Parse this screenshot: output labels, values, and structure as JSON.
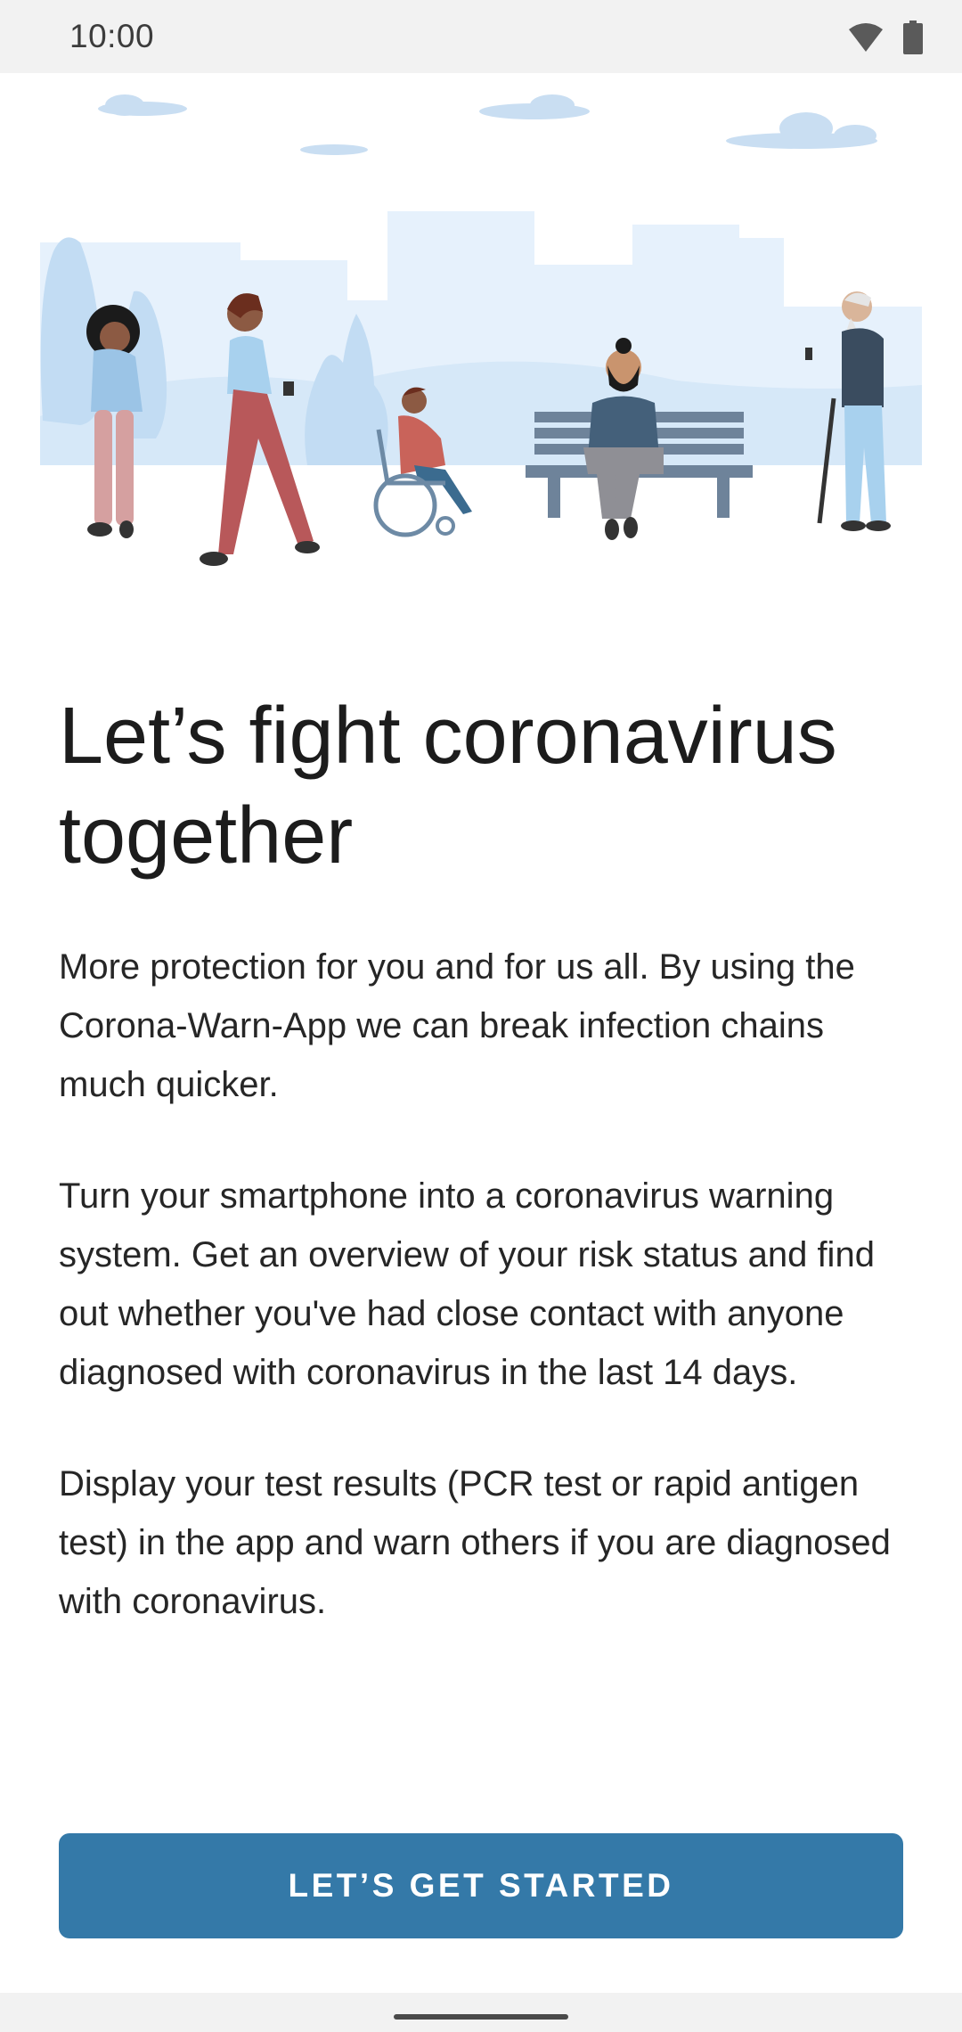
{
  "status_bar": {
    "time": "10:00",
    "icons": [
      "wifi-icon",
      "battery-icon"
    ]
  },
  "hero": {
    "illustration": "people-in-city-park-illustration"
  },
  "content": {
    "headline": "Let’s fight coronavirus together",
    "paragraphs": [
      "More protection for you and for us all. By using the Corona-Warn-App we can break infection chains much quicker.",
      "Turn your smartphone into a coronavirus warning system. Get an overview of your risk status and find out whether you've had close contact with anyone diagnosed with coronavirus in the last 14 days.",
      "Display your test results (PCR test or rapid antigen test) in the app and warn others if you are diagnosed with coronavirus."
    ]
  },
  "cta": {
    "label": "LET’S GET STARTED"
  },
  "colors": {
    "accent": "#3479a8",
    "illustration_light": "#e6f1fc",
    "illustration_mid": "#c6def4"
  }
}
